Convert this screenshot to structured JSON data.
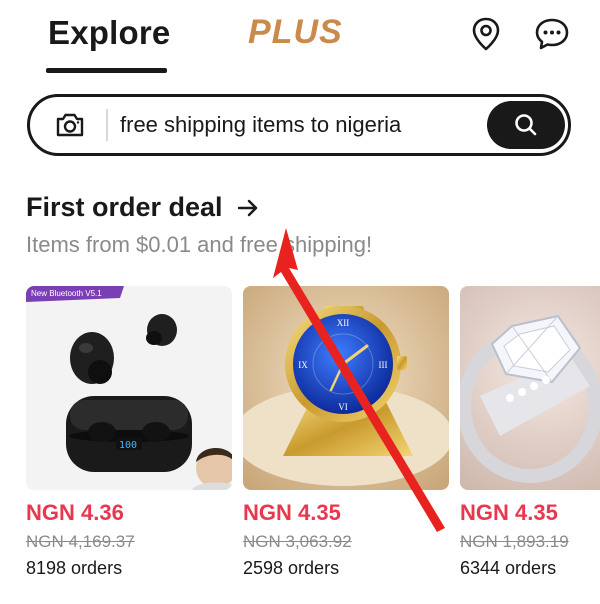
{
  "header": {
    "tabs": [
      {
        "label": "Explore",
        "active": true
      },
      {
        "label": "PLUS",
        "active": false
      }
    ],
    "icons": [
      "location-pin-icon",
      "chat-bubble-icon"
    ]
  },
  "search": {
    "value": "free shipping items to nigeria",
    "camera_icon": "camera-icon",
    "search_icon": "search-icon"
  },
  "deal": {
    "title": "First order deal",
    "arrow": "→",
    "subtitle": "Items from $0.01 and free shipping!"
  },
  "products": [
    {
      "price": "NGN 4.36",
      "old_price": "NGN 4,169.37",
      "orders": "8198 orders",
      "image": "wireless-earbuds",
      "image_banner": "New Bluetooth V5.1"
    },
    {
      "price": "NGN 4.35",
      "old_price": "NGN 3,063.92",
      "orders": "2598 orders",
      "image": "gold-watch"
    },
    {
      "price": "NGN 4.35",
      "old_price": "NGN 1,893.19",
      "orders": "6344 orders",
      "image": "diamond-ring"
    }
  ],
  "colors": {
    "text": "#191919",
    "brand_plus": "#c98a4b",
    "price": "#e8384f",
    "muted": "#8a8a8a",
    "annotation_arrow": "#e8231f"
  }
}
